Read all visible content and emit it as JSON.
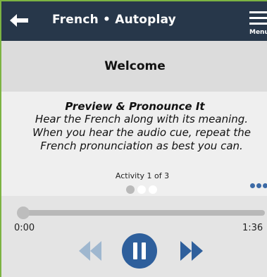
{
  "header": {
    "title": "French • Autoplay",
    "menu_label": "Menu",
    "icons": {
      "back": "back-arrow-icon",
      "menu": "hamburger-menu-icon"
    }
  },
  "welcome": {
    "title": "Welcome"
  },
  "activity_card": {
    "heading": "Preview & Pronounce It",
    "body": "Hear the French along with its meaning. When you hear the audio cue, repeat the French pronunciation as best you can.",
    "progress_label": "Activity 1 of 3",
    "current_activity": 1,
    "total_activities": 3
  },
  "player": {
    "elapsed": "0:00",
    "duration": "1:36",
    "position_fraction": 0,
    "controls": {
      "rewind": "rewind-icon",
      "pause": "pause-icon",
      "forward": "fast-forward-icon"
    }
  },
  "colors": {
    "header_bg": "#27374a",
    "accent_blue": "#2e5f9c",
    "disabled_blue": "#9fb7cf",
    "border_green": "#7cb342"
  }
}
